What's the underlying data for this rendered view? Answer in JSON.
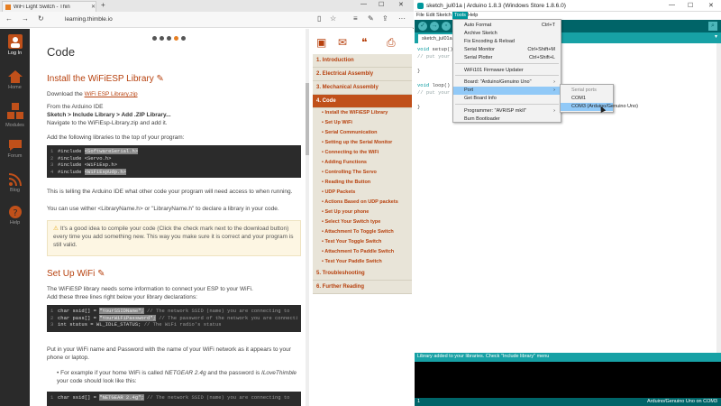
{
  "browser": {
    "tab_title": "WiFi Light Switch - Thin",
    "url": "learning.thimble.io"
  },
  "sidebar": {
    "items": [
      {
        "label": "Log In",
        "icon": "user-icon"
      },
      {
        "label": "Home",
        "icon": "home-icon"
      },
      {
        "label": "Modules",
        "icon": "boxes-icon"
      },
      {
        "label": "Forum",
        "icon": "chat-icon"
      },
      {
        "label": "Blog",
        "icon": "rss-icon"
      },
      {
        "label": "Help",
        "icon": "help-icon"
      }
    ]
  },
  "page": {
    "heading": "Code",
    "section1": {
      "title": "Install the WiFiESP Library",
      "download_prefix": "Download the ",
      "download_link": "WiFi ESP Library.zip",
      "ide_line": "From the Arduino IDE",
      "menu_path": "Sketch > Include Library > Add .ZIP Library...",
      "navigate": "Navigate to the WiFiEsp-Library.zip and add it.",
      "add_libs": "Add the following libraries to the top of your program:",
      "code": [
        {
          "n": "1",
          "a": "#include ",
          "h": "<SoftwareSerial.h>"
        },
        {
          "n": "2",
          "a": "#include <Servo.h>",
          "h": ""
        },
        {
          "n": "3",
          "a": "#include <WiFiEsp.h>",
          "h": ""
        },
        {
          "n": "4",
          "a": "#include ",
          "h": "<WiFiEspUdp.h>"
        }
      ],
      "explain1": "This is telling the Arduino IDE what other code your program will need access to when running.",
      "explain2": "You can use wither <LibraryName.h> or \"LibraryName.h\" to declare a library in your code.",
      "tip": "It's a good idea to compile your code (Click the check mark next to the download button) every time you add something new. This way you make sure it is correct and your program is still valid."
    },
    "section2": {
      "title": "Set Up WiFi",
      "intro1": "The WiFiESP library needs some information to connect your ESP to your WiFi.",
      "intro2": "Add these three lines right below your library declarations:",
      "code": [
        {
          "n": "1",
          "a": "char ssid[] = ",
          "h": "\"YourSSIDName\";",
          "c": "// The network SSID (name) you are connecting to"
        },
        {
          "n": "2",
          "a": "char pass[] = ",
          "h": "\"YourWiFiPassword\";",
          "c": "// The password of the network you are connecting to"
        },
        {
          "n": "3",
          "a": "int status = WL_IDLE_STATUS;",
          "h": "",
          "c": "// The WiFi radio's status"
        }
      ],
      "replace": "Put in your WiFi name and Password with the name of your WiFi network as it appears to your phone or laptop.",
      "example_prefix": "For example if your home WiFi is called ",
      "example_ssid": "NETGEAR 2.4g",
      "example_mid": " and the password is ",
      "example_pass": "ILoveThimble",
      "example_suffix": " your code should look like this:",
      "code2": [
        {
          "n": "1",
          "a": "char ssid[] = ",
          "h": "\"NETGEAR 2.4g\";",
          "c": "// The network SSID (name) you are connecting to"
        }
      ]
    }
  },
  "toc": {
    "items": [
      {
        "label": "1. Introduction",
        "active": false
      },
      {
        "label": "2. Electrical Assembly",
        "active": false
      },
      {
        "label": "3. Mechanical Assembly",
        "active": false
      },
      {
        "label": "4. Code",
        "active": true
      }
    ],
    "subitems": [
      "Install the WiFiESP Library",
      "Set Up WiFi",
      "Serial Communication",
      "Setting up the Serial Monitor",
      "Connecting to the WiFi",
      "Adding Functions",
      "Controlling The Servo",
      "Reading the Button",
      "UDP Packets",
      "Actions Based on UDP packets",
      "Set Up your phone",
      "Select Your Switch type",
      "Attachment To Toggle Switch",
      "Test Your Toggle Switch",
      "Attachment To Paddle Switch",
      "Test Your Paddle Switch"
    ],
    "after": [
      "5. Troubleshooting",
      "6. Further Reading"
    ]
  },
  "ide": {
    "title": "sketch_jul01a | Arduino 1.8.3 (Windows Store 1.8.6.0)",
    "menus": [
      "File",
      "Edit",
      "Sketch",
      "Tools",
      "Help"
    ],
    "open_menu": "Tools",
    "tab": "sketch_jul01a",
    "code": [
      {
        "kw": "void",
        "rest": " setup() {"
      },
      {
        "kw": "",
        "rest": "",
        "cm": "  // put your"
      },
      {
        "kw": "",
        "rest": ""
      },
      {
        "kw": "",
        "rest": "}"
      },
      {
        "kw": "",
        "rest": ""
      },
      {
        "kw": "void",
        "rest": " loop() {"
      },
      {
        "kw": "",
        "rest": "",
        "cm": "  // put your"
      },
      {
        "kw": "",
        "rest": ""
      },
      {
        "kw": "",
        "rest": "}"
      }
    ],
    "status": "Library added to your libraries. Check \"Include library\" menu",
    "line": "1",
    "board_port": "Arduino/Genuino Uno on COM3"
  },
  "tools_menu": {
    "items": [
      {
        "label": "Auto Format",
        "shortcut": "Ctrl+T"
      },
      {
        "label": "Archive Sketch",
        "shortcut": ""
      },
      {
        "label": "Fix Encoding & Reload",
        "shortcut": ""
      },
      {
        "label": "Serial Monitor",
        "shortcut": "Ctrl+Shift+M"
      },
      {
        "label": "Serial Plotter",
        "shortcut": "Ctrl+Shift+L"
      },
      {
        "label": "WiFi101 Firmware Updater",
        "shortcut": ""
      },
      {
        "label": "Board: \"Arduino/Genuino Uno\"",
        "shortcut": "›"
      },
      {
        "label": "Port",
        "shortcut": "›"
      },
      {
        "label": "Get Board Info",
        "shortcut": ""
      },
      {
        "label": "Programmer: \"AVRISP mkII\"",
        "shortcut": "›"
      },
      {
        "label": "Burn Bootloader",
        "shortcut": ""
      }
    ]
  },
  "port_menu": {
    "header": "Serial ports",
    "items": [
      "COM1",
      "COM3 (Arduino/Genuino Uno)"
    ]
  },
  "colors": {
    "accent": "#b7410e",
    "toc_active": "#c0501a",
    "arduino_teal": "#00979c",
    "arduino_dark": "#006468"
  }
}
